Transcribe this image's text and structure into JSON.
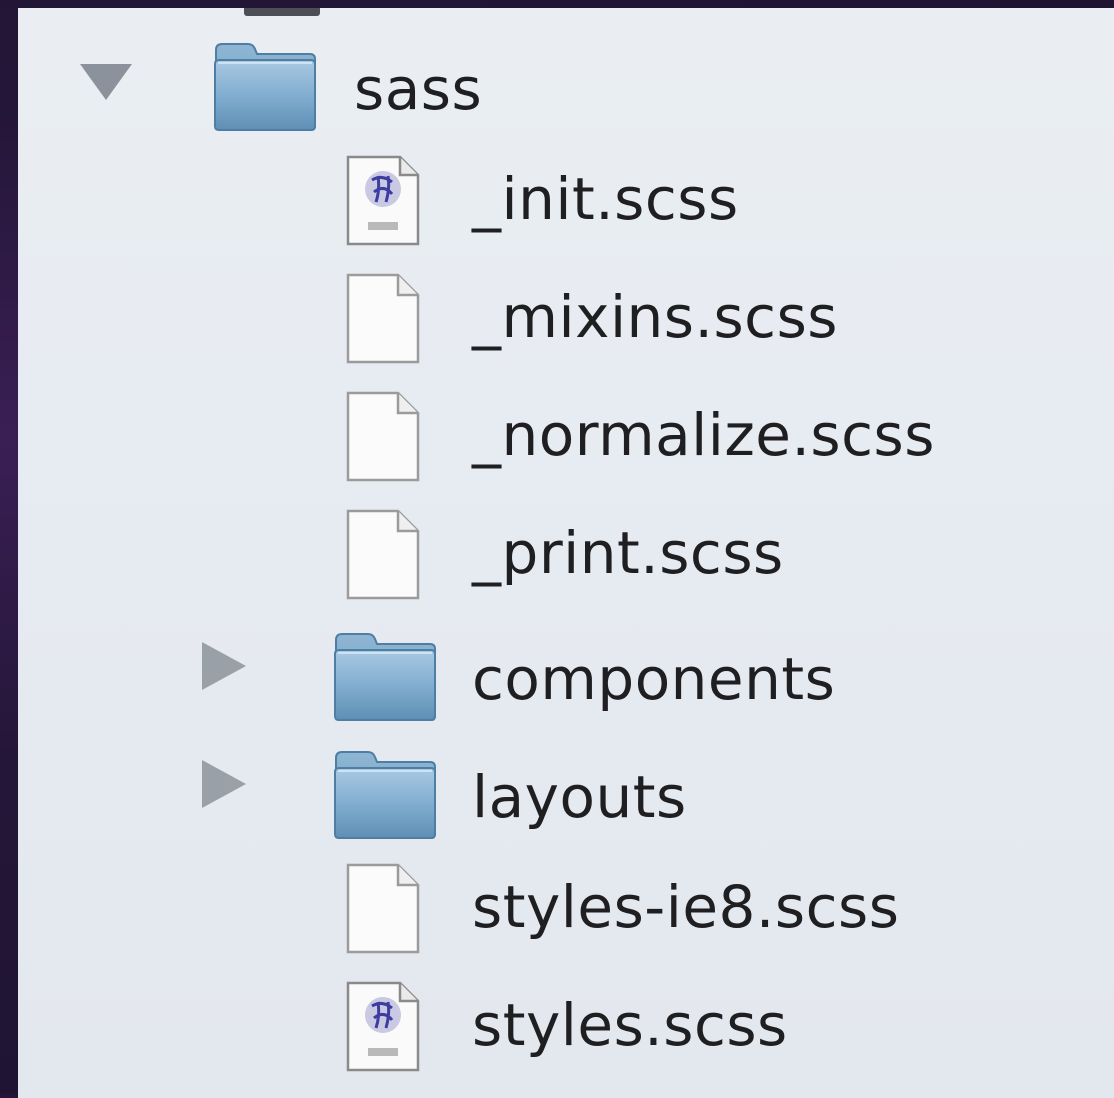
{
  "file_tree": {
    "root": {
      "name": "sass",
      "icon": "folder-icon",
      "expanded": true
    },
    "items": [
      {
        "name": "_init.scss",
        "icon": "sass-document-icon",
        "kind": "file"
      },
      {
        "name": "_mixins.scss",
        "icon": "blank-document-icon",
        "kind": "file"
      },
      {
        "name": "_normalize.scss",
        "icon": "blank-document-icon",
        "kind": "file"
      },
      {
        "name": "_print.scss",
        "icon": "blank-document-icon",
        "kind": "file"
      },
      {
        "name": "components",
        "icon": "folder-icon",
        "kind": "folder",
        "expanded": false
      },
      {
        "name": "layouts",
        "icon": "folder-icon",
        "kind": "folder",
        "expanded": false
      },
      {
        "name": "styles-ie8.scss",
        "icon": "blank-document-icon",
        "kind": "file"
      },
      {
        "name": "styles.scss",
        "icon": "sass-document-icon",
        "kind": "file"
      }
    ]
  },
  "colors": {
    "background": "#241638",
    "panel": "#e6ebf1",
    "folder": "#7aa6c8",
    "text": "#1f1f22",
    "disclosure": "#8c929b"
  }
}
